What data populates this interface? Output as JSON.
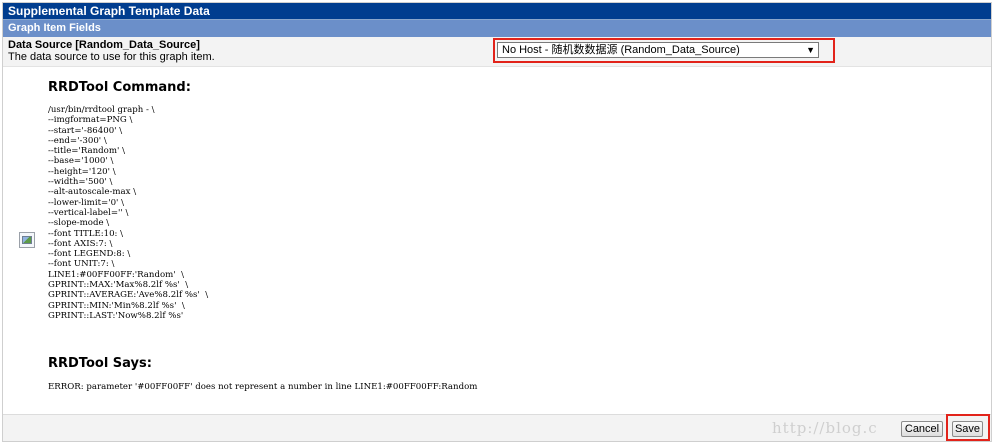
{
  "header": {
    "title": "Supplemental Graph Template Data",
    "subtitle": "Graph Item Fields"
  },
  "field": {
    "label": "Data Source [Random_Data_Source]",
    "description": "The data source to use for this graph item.",
    "selected_value": "No Host - 随机数数据源 (Random_Data_Source)",
    "dropdown_icon": "chevron-down-icon"
  },
  "rrdtool": {
    "command_heading": "RRDTool Command:",
    "command_lines": [
      "/usr/bin/rrdtool graph - \\",
      "--imgformat=PNG \\",
      "--start='-86400' \\",
      "--end='-300' \\",
      "--title='Random' \\",
      "--base='1000' \\",
      "--height='120' \\",
      "--width='500' \\",
      "--alt-autoscale-max \\",
      "--lower-limit='0' \\",
      "--vertical-label='' \\",
      "--slope-mode \\",
      "--font TITLE:10: \\",
      "--font AXIS:7: \\",
      "--font LEGEND:8: \\",
      "--font UNIT:7: \\",
      "LINE1:#00FF00FF:'Random'  \\",
      "GPRINT::MAX:'Max%8.2lf %s'  \\",
      "GPRINT::AVERAGE:'Ave%8.2lf %s'  \\",
      "GPRINT::MIN:'Min%8.2lf %s'  \\",
      "GPRINT::LAST:'Now%8.2lf %s'"
    ],
    "says_heading": "RRDTool Says:",
    "error_message": "ERROR: parameter '#00FF00FF' does not represent a number in line LINE1:#00FF00FF:Random"
  },
  "graph_image": {
    "icon": "broken-image-icon"
  },
  "footer": {
    "watermark": "http://blog.c",
    "cancel_label": "Cancel",
    "save_label": "Save"
  },
  "colors": {
    "header_bg": "#003d8f",
    "subheader_bg": "#6b8fc9",
    "highlight": "#e2231a"
  }
}
